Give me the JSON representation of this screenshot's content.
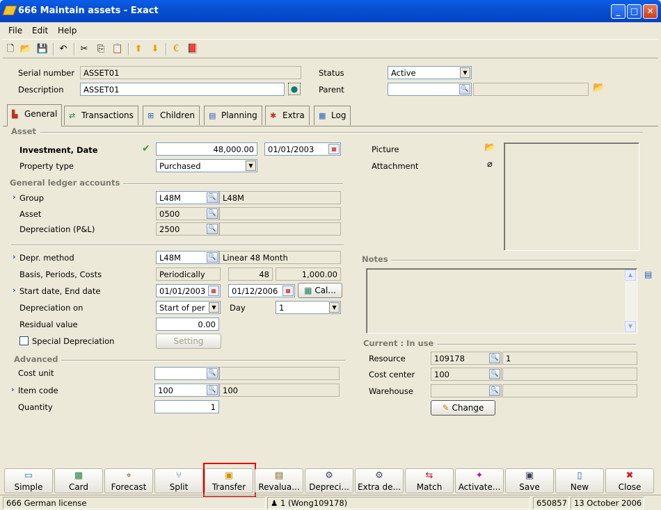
{
  "window": {
    "title": "666 Maintain assets - Exact"
  },
  "menu": [
    "File",
    "Edit",
    "Help"
  ],
  "header": {
    "serial_label": "Serial number",
    "serial_value": "ASSET01",
    "description_label": "Description",
    "description_value": "ASSET01",
    "status_label": "Status",
    "status_value": "Active",
    "parent_label": "Parent",
    "parent_value": ""
  },
  "tabs": [
    {
      "label": "General",
      "icon": "general-icon"
    },
    {
      "label": "Transactions",
      "icon": "transactions-icon"
    },
    {
      "label": "Children",
      "icon": "children-icon"
    },
    {
      "label": "Planning",
      "icon": "planning-icon"
    },
    {
      "label": "Extra",
      "icon": "extra-icon"
    },
    {
      "label": "Log",
      "icon": "log-icon"
    }
  ],
  "asset": {
    "section": "Asset",
    "investment_label": "Investment, Date",
    "investment_amount": "48,000.00",
    "investment_date": "01/01/2003",
    "property_label": "Property type",
    "property_value": "Purchased"
  },
  "gl": {
    "section": "General ledger accounts",
    "group_label": "Group",
    "group_code": "L48M",
    "group_desc": "L48M",
    "asset_label": "Asset",
    "asset_code": "0500",
    "asset_desc": "",
    "depr_label": "Depreciation (P&L)",
    "depr_code": "2500",
    "depr_desc": ""
  },
  "depr": {
    "method_label": "Depr. method",
    "method_code": "L48M",
    "method_desc": "Linear 48 Month",
    "basis_label": "Basis, Periods, Costs",
    "basis_value": "Periodically",
    "periods": "48",
    "costs": "1,000.00",
    "dates_label": "Start date, End date",
    "start": "01/01/2003",
    "end": "01/12/2006",
    "calc_button": "Cal...",
    "on_label": "Depreciation on",
    "on_value": "Start of per",
    "day_label": "Day",
    "day_value": "1",
    "residual_label": "Residual value",
    "residual_value": "0.00",
    "special_label": "Special Depreciation",
    "setting_button": "Setting"
  },
  "advanced": {
    "section": "Advanced",
    "cost_unit_label": "Cost unit",
    "cost_unit_value": "",
    "item_label": "Item code",
    "item_code": "100",
    "item_desc": "100",
    "qty_label": "Quantity",
    "qty_value": "1"
  },
  "right": {
    "picture_label": "Picture",
    "attachment_label": "Attachment",
    "notes_section": "Notes",
    "current_section": "Current : In use",
    "resource_label": "Resource",
    "resource_code": "109178",
    "resource_desc": "1",
    "cost_center_label": "Cost center",
    "cost_center_code": "100",
    "cost_center_desc": "",
    "warehouse_label": "Warehouse",
    "warehouse_code": "",
    "warehouse_desc": "",
    "change_button": "Change"
  },
  "bottom_buttons": [
    "Simple",
    "Card",
    "Forecast",
    "Split",
    "Transfer",
    "Revalua...",
    "Depreci...",
    "Extra de...",
    "Match",
    "Activate...",
    "Save",
    "New",
    "Close"
  ],
  "status": {
    "license": "666 German license",
    "user": "1 (Wong109178)",
    "code": "650857",
    "date": "13 October 2006"
  },
  "colors": {
    "title_bar": "#0a5ee8",
    "highlight": "#e00000",
    "face": "#ece9d8"
  }
}
